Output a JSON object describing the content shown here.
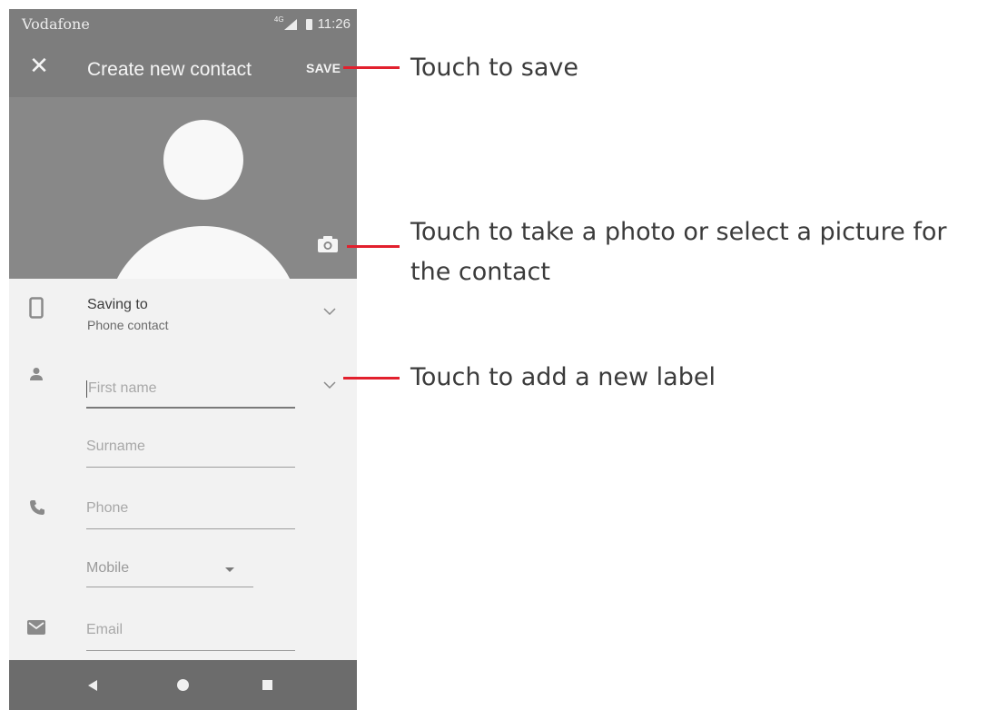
{
  "status_bar": {
    "carrier": "Vodafone",
    "network": "4G",
    "time": "11:26",
    "icons": [
      "signal-icon",
      "battery-icon"
    ]
  },
  "app_bar": {
    "close_icon": "close-icon",
    "title": "Create new contact",
    "save_label": "SAVE"
  },
  "photo": {
    "camera_icon": "camera-icon"
  },
  "form": {
    "account": {
      "label": "Saving to",
      "value": "Phone contact",
      "icon": "phone-device-icon"
    },
    "first_name": {
      "placeholder": "First name",
      "icon": "person-icon"
    },
    "surname": {
      "placeholder": "Surname"
    },
    "phone": {
      "placeholder": "Phone",
      "icon": "phone-icon"
    },
    "phone_type": {
      "selected": "Mobile"
    },
    "email": {
      "placeholder": "Email",
      "icon": "email-icon"
    }
  },
  "nav_bar": {
    "icons": [
      "back-icon",
      "home-icon",
      "recents-icon"
    ]
  },
  "annotations": {
    "save": "Touch to save",
    "photo_line1": "Touch to take a photo or select a picture for",
    "photo_line2": "the contact",
    "label": "Touch to add a new label"
  },
  "colors": {
    "annotation_line": "#e2202d",
    "header": "#7d7d7d",
    "photo_bg": "#888888",
    "nav": "#6c6c6c"
  }
}
